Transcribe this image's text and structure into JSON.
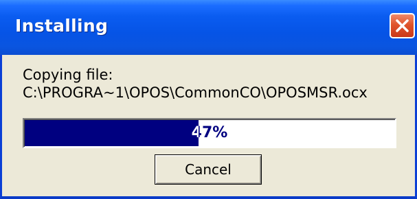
{
  "window": {
    "title": "Installing"
  },
  "content": {
    "label": "Copying file:",
    "path": "C:\\PROGRA~1\\OPOS\\CommonCO\\OPOSMSR.ocx"
  },
  "progress": {
    "percent": 47,
    "text": "47%"
  },
  "buttons": {
    "cancel_label": "Cancel"
  },
  "icons": {
    "close": "close-icon"
  },
  "colors": {
    "titlebar": "#0a5cf0",
    "progress_fill": "#000080",
    "close_button": "#e0542b",
    "dialog_bg": "#ece9d8"
  }
}
